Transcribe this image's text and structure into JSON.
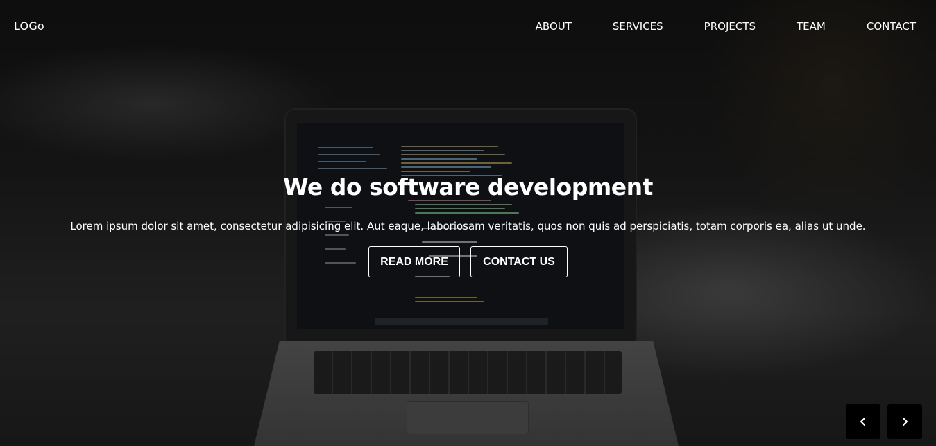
{
  "nav": {
    "logo": "LOGo",
    "links": [
      "ABOUT",
      "SERVICES",
      "PROJECTS",
      "TEAM",
      "CONTACT"
    ]
  },
  "hero": {
    "title": "We do software development",
    "subtitle": "Lorem ipsum dolor sit amet, consectetur adipisicing elit. Aut eaque, laboriosam veritatis, quos non quis ad perspiciatis, totam corporis ea, alias ut unde.",
    "read_more_label": "READ MORE",
    "contact_label": "CONTACT US"
  },
  "carousel": {
    "prev_icon": "chevron-left-icon",
    "next_icon": "chevron-right-icon"
  },
  "colors": {
    "text": "#ffffff",
    "arrow_bg": "#000000"
  }
}
